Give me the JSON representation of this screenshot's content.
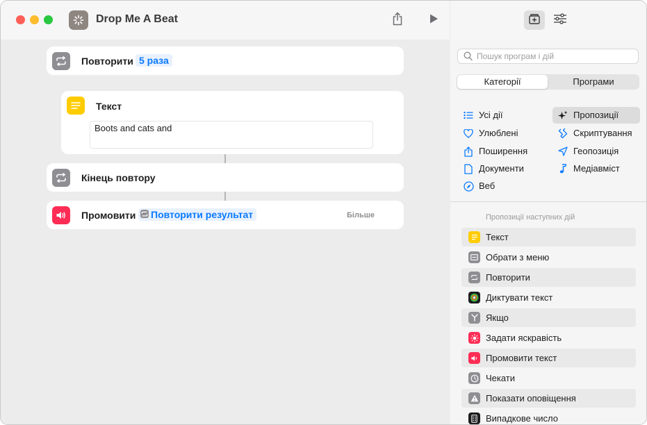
{
  "window": {
    "title": "Drop Me A Beat"
  },
  "workflow": {
    "repeat": {
      "title": "Повторити",
      "count_token": "5 раза"
    },
    "text": {
      "title": "Текст",
      "value": "Boots and cats and"
    },
    "end_repeat": {
      "title": "Кінець повтору"
    },
    "speak": {
      "title": "Промовити",
      "token": "Повторити результат",
      "more_label": "Більше"
    }
  },
  "sidebar": {
    "search_placeholder": "Пошук програм і дій",
    "tabs": [
      "Категорії",
      "Програми"
    ],
    "categories_left": [
      "Усі дії",
      "Улюблені",
      "Поширення",
      "Документи",
      "Веб"
    ],
    "categories_right": [
      "Пропозиції",
      "Скриптування",
      "Геопозиція",
      "Медіавміст"
    ],
    "suggestions_title": "Пропозиції наступних дій",
    "suggestions": [
      {
        "label": "Текст",
        "icon": "text-icon",
        "color": "#ffcc00"
      },
      {
        "label": "Обрати з меню",
        "icon": "menu-icon",
        "color": "#8e8e93"
      },
      {
        "label": "Повторити",
        "icon": "repeat-icon",
        "color": "#8e8e93"
      },
      {
        "label": "Диктувати текст",
        "icon": "dictate-icon",
        "color": "#1c1c1e"
      },
      {
        "label": "Якщо",
        "icon": "if-icon",
        "color": "#8e8e93"
      },
      {
        "label": "Задати яскравість",
        "icon": "brightness-icon",
        "color": "#ff2d55"
      },
      {
        "label": "Промовити текст",
        "icon": "speaker-icon",
        "color": "#ff2d55"
      },
      {
        "label": "Чекати",
        "icon": "clock-icon",
        "color": "#8e8e93"
      },
      {
        "label": "Показати оповіщення",
        "icon": "alert-icon",
        "color": "#8e8e93"
      },
      {
        "label": "Випадкове число",
        "icon": "dice-icon",
        "color": "#1c1c1e"
      }
    ]
  },
  "colors": {
    "accent": "#0a7aff",
    "token_bg": "#e8f1fd"
  }
}
